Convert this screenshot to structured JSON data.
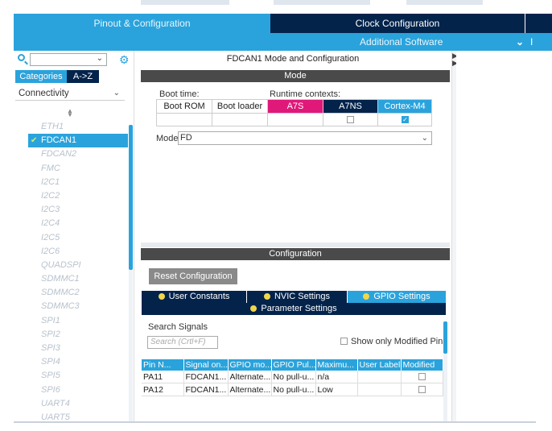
{
  "tabs": {
    "pinout": "Pinout & Configuration",
    "clock": "Clock Configuration",
    "additional_software": "Additional Software",
    "extra_cut": "I"
  },
  "left": {
    "category_tab": "Categories",
    "az_tab": "A->Z",
    "dropdown": "Connectivity",
    "peripherals": [
      {
        "label": "ETH1",
        "selected": false
      },
      {
        "label": "FDCAN1",
        "selected": true
      },
      {
        "label": "FDCAN2",
        "selected": false
      },
      {
        "label": "FMC",
        "selected": false
      },
      {
        "label": "I2C1",
        "selected": false
      },
      {
        "label": "I2C2",
        "selected": false
      },
      {
        "label": "I2C3",
        "selected": false
      },
      {
        "label": "I2C4",
        "selected": false
      },
      {
        "label": "I2C5",
        "selected": false
      },
      {
        "label": "I2C6",
        "selected": false
      },
      {
        "label": "QUADSPI",
        "selected": false
      },
      {
        "label": "SDMMC1",
        "selected": false
      },
      {
        "label": "SDMMC2",
        "selected": false
      },
      {
        "label": "SDMMC3",
        "selected": false
      },
      {
        "label": "SPI1",
        "selected": false
      },
      {
        "label": "SPI2",
        "selected": false
      },
      {
        "label": "SPI3",
        "selected": false
      },
      {
        "label": "SPI4",
        "selected": false
      },
      {
        "label": "SPI5",
        "selected": false
      },
      {
        "label": "SPI6",
        "selected": false
      },
      {
        "label": "UART4",
        "selected": false
      },
      {
        "label": "UART5",
        "selected": false
      }
    ]
  },
  "mode": {
    "title": "FDCAN1 Mode and Configuration",
    "section": "Mode",
    "boot_time": "Boot time:",
    "runtime_contexts": "Runtime contexts:",
    "col_bootrom": "Boot ROM",
    "col_bootloader": "Boot loader",
    "col_a7s": "A7S",
    "col_a7ns": "A7NS",
    "col_cortex": "Cortex-M4",
    "mode_label": "Mode",
    "mode_value": "FD"
  },
  "config": {
    "section": "Configuration",
    "reset": "Reset Configuration",
    "tab_user_constants": "User Constants",
    "tab_nvic": "NVIC Settings",
    "tab_gpio": "GPIO Settings",
    "tab_param": "Parameter Settings",
    "search_signals": "Search Signals",
    "search_placeholder": "Search (Crtl+F)",
    "show_modified": "Show only Modified Pins",
    "headers": [
      "Pin N...",
      "Signal on...",
      "GPIO mo...",
      "GPIO Pul...",
      "Maximu...",
      "User Label",
      "Modified"
    ],
    "rows": [
      [
        "PA11",
        "FDCAN1...",
        "Alternate...",
        "No pull-u...",
        "n/a",
        "",
        ""
      ],
      [
        "PA12",
        "FDCAN1...",
        "Alternate...",
        "No pull-u...",
        "Low",
        "",
        ""
      ]
    ]
  },
  "colors": {
    "accent": "#2aa3dc",
    "navy": "#03234b",
    "a7s_magenta": "#e0187a",
    "section_bar": "#4a4a4a"
  }
}
